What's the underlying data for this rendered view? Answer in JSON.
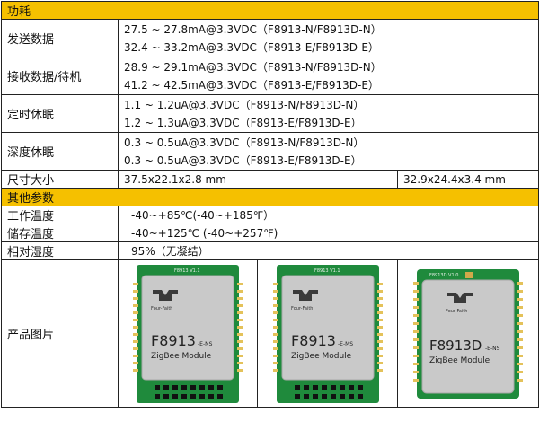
{
  "sections": {
    "power_header": "功耗",
    "other_header": "其他参数"
  },
  "rows": {
    "send": {
      "label": "发送数据",
      "line1": "27.5 ~ 27.8mA@3.3VDC（F8913-N/F8913D-N）",
      "line2": "32.4 ~ 33.2mA@3.3VDC（F8913-E/F8913D-E）"
    },
    "receive": {
      "label": "接收数据/待机",
      "line1": "28.9 ~ 29.1mA@3.3VDC（F8913-N/F8913D-N）",
      "line2": "41.2 ~ 42.5mA@3.3VDC（F8913-E/F8913D-E）"
    },
    "timed_sleep": {
      "label": "定时休眠",
      "line1": "1.1 ~ 1.2uA@3.3VDC（F8913-N/F8913D-N）",
      "line2": "1.2 ~ 1.3uA@3.3VDC（F8913-E/F8913D-E）"
    },
    "deep_sleep": {
      "label": "深度休眠",
      "line1": "0.3 ~ 0.5uA@3.3VDC（F8913-N/F8913D-N）",
      "line2": "0.3 ~ 0.5uA@3.3VDC（F8913-E/F8913D-E）"
    },
    "size": {
      "label": "尺寸大小",
      "value_a": "37.5x22.1x2.8 mm",
      "value_b": "32.9x24.4x3.4 mm"
    },
    "work_temp": {
      "label": "工作温度",
      "value": "-40~+85℃(-40~+185℉）"
    },
    "storage_temp": {
      "label": "储存温度",
      "value": "-40~+125℃ (-40~+257℉)"
    },
    "humidity": {
      "label": "相对湿度",
      "value": "95%（无凝结）"
    },
    "product_image": {
      "label": "产品图片"
    }
  },
  "products": [
    {
      "board_tag": "F8913 V1.1",
      "brand": "Four-Faith",
      "model": "F8913",
      "suffix": "-E-NS",
      "subtitle": "ZigBee Module"
    },
    {
      "board_tag": "F8913 V1.1",
      "brand": "Four-Faith",
      "model": "F8913",
      "suffix": "-E-MS",
      "subtitle": "ZigBee Module"
    },
    {
      "board_tag": "F8913D V1.0",
      "brand": "Four-Faith",
      "model": "F8913D",
      "suffix": "-E-NS",
      "subtitle": "ZigBee Module"
    }
  ],
  "colors": {
    "header_bg": "#f5c000",
    "pcb_green": "#1f8a3c",
    "shield_gray": "#c9c9c9"
  }
}
